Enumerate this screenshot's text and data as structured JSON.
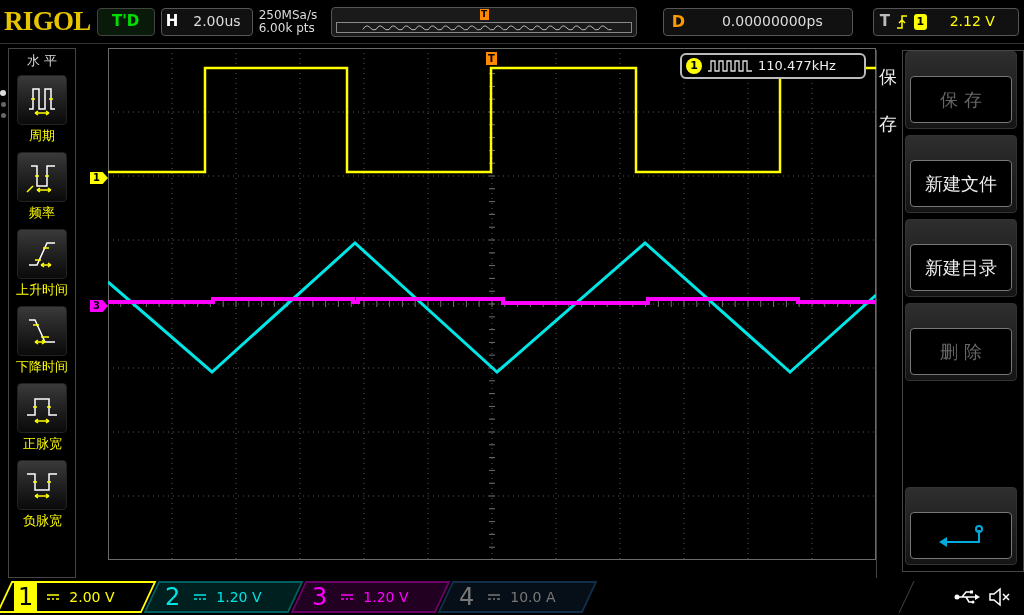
{
  "header": {
    "logo": "RIGOL",
    "trigger_status": "T'D",
    "horizontal": {
      "label": "H",
      "value": "2.00us"
    },
    "sample_rate": "250MSa/s",
    "memory_depth": "6.00k pts",
    "trigger_position": "T",
    "delay": {
      "label": "D",
      "value": "0.00000000ps"
    },
    "trigger": {
      "label": "T",
      "source": "1",
      "level": "2.12 V"
    }
  },
  "left_menu": {
    "title": "水 平",
    "items": [
      {
        "kind": "period",
        "label": "周期"
      },
      {
        "kind": "frequency",
        "label": "频率"
      },
      {
        "kind": "rise",
        "label": "上升时间"
      },
      {
        "kind": "fall",
        "label": "下降时间"
      },
      {
        "kind": "pos_width",
        "label": "正脉宽"
      },
      {
        "kind": "neg_width",
        "label": "负脉宽"
      }
    ],
    "pages": [
      {
        "selected": true
      },
      {
        "selected": false
      },
      {
        "selected": false
      }
    ]
  },
  "display": {
    "trigger_marker": "T",
    "channel_markers": [
      {
        "label": "1",
        "color": "#ffff00"
      },
      {
        "label": "3",
        "color": "#ff00ff"
      }
    ],
    "measurement": {
      "channel": "1",
      "value": "110.477kHz"
    }
  },
  "right_menu": {
    "title": "保存",
    "items": [
      {
        "kind": "text",
        "label": "保 存",
        "disabled": true
      },
      {
        "kind": "text",
        "label": "新建文件",
        "disabled": false
      },
      {
        "kind": "text",
        "label": "新建目录",
        "disabled": false
      },
      {
        "kind": "text",
        "label": "删 除",
        "disabled": true
      },
      {
        "kind": "back"
      }
    ]
  },
  "channels": [
    {
      "number": "1",
      "scale": "2.00 V",
      "color": "#ffff00",
      "selected": true,
      "enabled": true
    },
    {
      "number": "2",
      "scale": "1.20 V",
      "color": "#00e5e5",
      "selected": false,
      "enabled": true
    },
    {
      "number": "3",
      "scale": "1.20 V",
      "color": "#ff00ff",
      "selected": false,
      "enabled": true
    },
    {
      "number": "4",
      "scale": "10.0 A",
      "color": "#777777",
      "selected": false,
      "enabled": false
    }
  ]
}
